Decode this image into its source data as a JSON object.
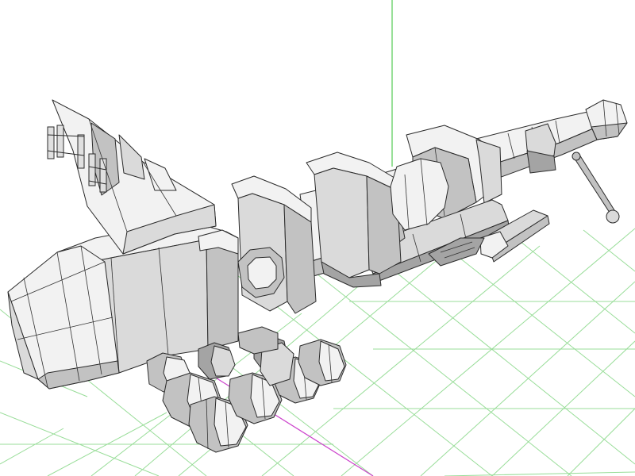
{
  "viewport": {
    "grid_color": "#99dd99",
    "vertical_axis_color": "#55cc55",
    "horizontal_axis_color": "#cc44cc",
    "model_color": "#c8c8c8",
    "wire_color": "#2a2a2a"
  },
  "model": {
    "icon": "wireframe-mesh-icon",
    "parts": [
      "cannon-barrel",
      "muzzle-tip",
      "rear-housing",
      "rear-cone",
      "clamp-ring-front",
      "clamp-ring-mid",
      "clamp-ring-rear",
      "side-rail",
      "handle-arm",
      "rod",
      "fin-bracket",
      "wheel-set"
    ]
  }
}
